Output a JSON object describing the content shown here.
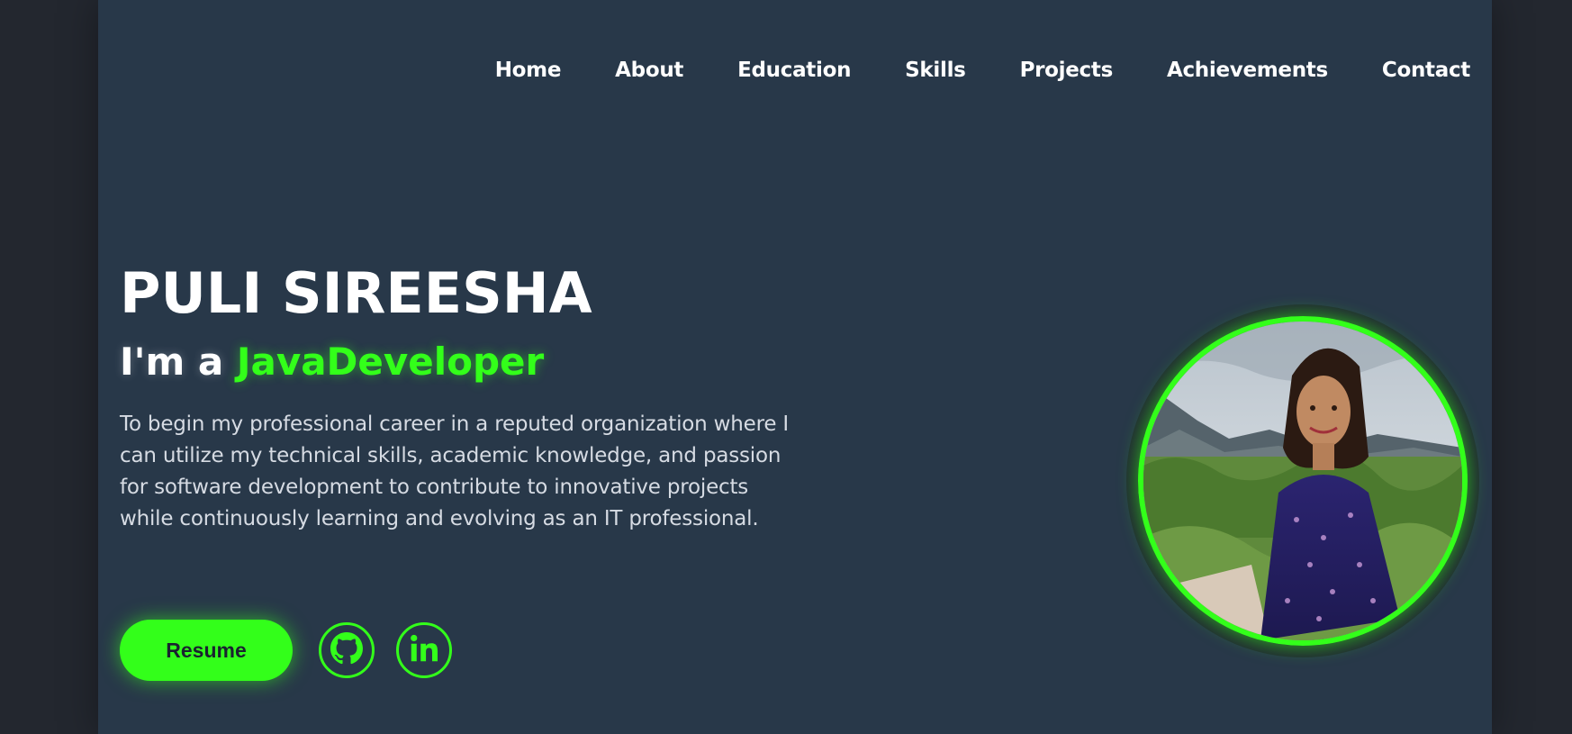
{
  "nav": {
    "items": [
      {
        "label": "Home"
      },
      {
        "label": "About"
      },
      {
        "label": "Education"
      },
      {
        "label": "Skills"
      },
      {
        "label": "Projects"
      },
      {
        "label": "Achievements"
      },
      {
        "label": "Contact"
      }
    ]
  },
  "hero": {
    "name": "PULI SIREESHA",
    "role_prefix": "I'm a ",
    "role_highlight": "JavaDeveloper",
    "bio": "To begin my professional career in a reputed organization where I can utilize my technical skills, academic knowledge, and passion for software development to contribute to innovative projects while continuously learning and evolving as an IT professional."
  },
  "actions": {
    "resume_label": "Resume",
    "github_icon": "github-icon",
    "linkedin_icon": "linkedin-icon"
  },
  "profile_photo": {
    "description_icon": "profile-photo"
  },
  "colors": {
    "accent": "#33ff1a",
    "page_bg": "#283849",
    "outer_bg": "#23272f",
    "text": "#ffffff"
  }
}
